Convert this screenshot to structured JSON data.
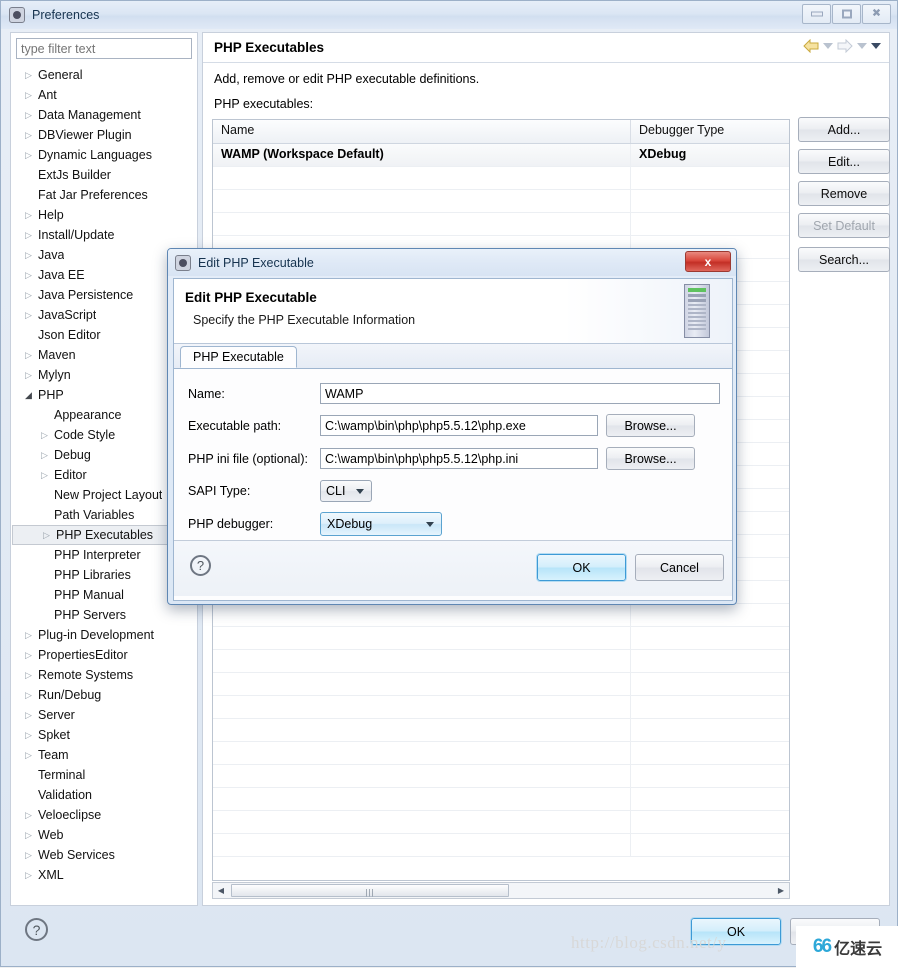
{
  "window": {
    "title": "Preferences",
    "icon": "gear-icon",
    "controls": {
      "minimize": "minimize-icon",
      "restore": "restore-icon",
      "close": "close-icon"
    }
  },
  "sidebar": {
    "filter": {
      "placeholder": "type filter text",
      "value": ""
    },
    "items": [
      {
        "label": "General",
        "arrow": "collapsed",
        "indent": 0
      },
      {
        "label": "Ant",
        "arrow": "collapsed",
        "indent": 0
      },
      {
        "label": "Data Management",
        "arrow": "collapsed",
        "indent": 0
      },
      {
        "label": "DBViewer Plugin",
        "arrow": "collapsed",
        "indent": 0
      },
      {
        "label": "Dynamic Languages",
        "arrow": "collapsed",
        "indent": 0
      },
      {
        "label": "ExtJs Builder",
        "arrow": "none",
        "indent": 0
      },
      {
        "label": "Fat Jar Preferences",
        "arrow": "none",
        "indent": 0
      },
      {
        "label": "Help",
        "arrow": "collapsed",
        "indent": 0
      },
      {
        "label": "Install/Update",
        "arrow": "collapsed",
        "indent": 0
      },
      {
        "label": "Java",
        "arrow": "collapsed",
        "indent": 0
      },
      {
        "label": "Java EE",
        "arrow": "collapsed",
        "indent": 0
      },
      {
        "label": "Java Persistence",
        "arrow": "collapsed",
        "indent": 0
      },
      {
        "label": "JavaScript",
        "arrow": "collapsed",
        "indent": 0
      },
      {
        "label": "Json Editor",
        "arrow": "none",
        "indent": 0
      },
      {
        "label": "Maven",
        "arrow": "collapsed",
        "indent": 0
      },
      {
        "label": "Mylyn",
        "arrow": "collapsed",
        "indent": 0
      },
      {
        "label": "PHP",
        "arrow": "expanded",
        "indent": 0
      },
      {
        "label": "Appearance",
        "arrow": "none",
        "indent": 1
      },
      {
        "label": "Code Style",
        "arrow": "collapsed",
        "indent": 1
      },
      {
        "label": "Debug",
        "arrow": "collapsed",
        "indent": 1
      },
      {
        "label": "Editor",
        "arrow": "collapsed",
        "indent": 1
      },
      {
        "label": "New Project Layout",
        "arrow": "none",
        "indent": 1
      },
      {
        "label": "Path Variables",
        "arrow": "none",
        "indent": 1
      },
      {
        "label": "PHP Executables",
        "arrow": "collapsed",
        "indent": 1,
        "selected": true
      },
      {
        "label": "PHP Interpreter",
        "arrow": "none",
        "indent": 1
      },
      {
        "label": "PHP Libraries",
        "arrow": "none",
        "indent": 1
      },
      {
        "label": "PHP Manual",
        "arrow": "none",
        "indent": 1
      },
      {
        "label": "PHP Servers",
        "arrow": "none",
        "indent": 1
      },
      {
        "label": "Plug-in Development",
        "arrow": "collapsed",
        "indent": 0
      },
      {
        "label": "PropertiesEditor",
        "arrow": "collapsed",
        "indent": 0
      },
      {
        "label": "Remote Systems",
        "arrow": "collapsed",
        "indent": 0
      },
      {
        "label": "Run/Debug",
        "arrow": "collapsed",
        "indent": 0
      },
      {
        "label": "Server",
        "arrow": "collapsed",
        "indent": 0
      },
      {
        "label": "Spket",
        "arrow": "collapsed",
        "indent": 0
      },
      {
        "label": "Team",
        "arrow": "collapsed",
        "indent": 0
      },
      {
        "label": "Terminal",
        "arrow": "none",
        "indent": 0
      },
      {
        "label": "Validation",
        "arrow": "none",
        "indent": 0
      },
      {
        "label": "Veloeclipse",
        "arrow": "collapsed",
        "indent": 0
      },
      {
        "label": "Web",
        "arrow": "collapsed",
        "indent": 0
      },
      {
        "label": "Web Services",
        "arrow": "collapsed",
        "indent": 0
      },
      {
        "label": "XML",
        "arrow": "collapsed",
        "indent": 0
      }
    ]
  },
  "page": {
    "title": "PHP Executables",
    "description": "Add, remove or edit PHP executable definitions.",
    "list_label": "PHP executables:",
    "nav": {
      "back": "back-arrow-icon",
      "forward": "forward-arrow-icon",
      "menu": "dropdown-arrow-icon"
    },
    "table": {
      "columns": [
        "Name",
        "Debugger Type"
      ],
      "rows": [
        {
          "name": "WAMP (Workspace Default)",
          "debugger": "XDebug"
        }
      ],
      "empty_row_count": 30
    },
    "buttons": [
      {
        "label": "Add...",
        "enabled": true
      },
      {
        "label": "Edit...",
        "enabled": true
      },
      {
        "label": "Remove",
        "enabled": true
      },
      {
        "label": "Set Default",
        "enabled": false
      },
      {
        "label": "Search...",
        "enabled": true
      }
    ]
  },
  "footer": {
    "help": "?",
    "ok_label": "OK",
    "cancel_label": ""
  },
  "watermark": {
    "url": "http://blog.csdn.net/y",
    "logo_text": "亿速云",
    "logo_mark": "66"
  },
  "dialog": {
    "title": "Edit PHP Executable",
    "icon": "gear-icon",
    "close_label": "x",
    "heading": "Edit PHP Executable",
    "subheading": "Specify the PHP Executable Information",
    "banner_icon": "server-icon",
    "tab": "PHP Executable",
    "fields": {
      "name_label": "Name:",
      "name_value": "WAMP",
      "exec_label": "Executable path:",
      "exec_value": "C:\\wamp\\bin\\php\\php5.5.12\\php.exe",
      "exec_browse": "Browse...",
      "ini_label": "PHP ini file (optional):",
      "ini_value": "C:\\wamp\\bin\\php\\php5.5.12\\php.ini",
      "ini_browse": "Browse...",
      "sapi_label": "SAPI Type:",
      "sapi_value": "CLI",
      "debugger_label": "PHP debugger:",
      "debugger_value": "XDebug"
    },
    "help": "?",
    "ok_label": "OK",
    "cancel_label": "Cancel"
  }
}
